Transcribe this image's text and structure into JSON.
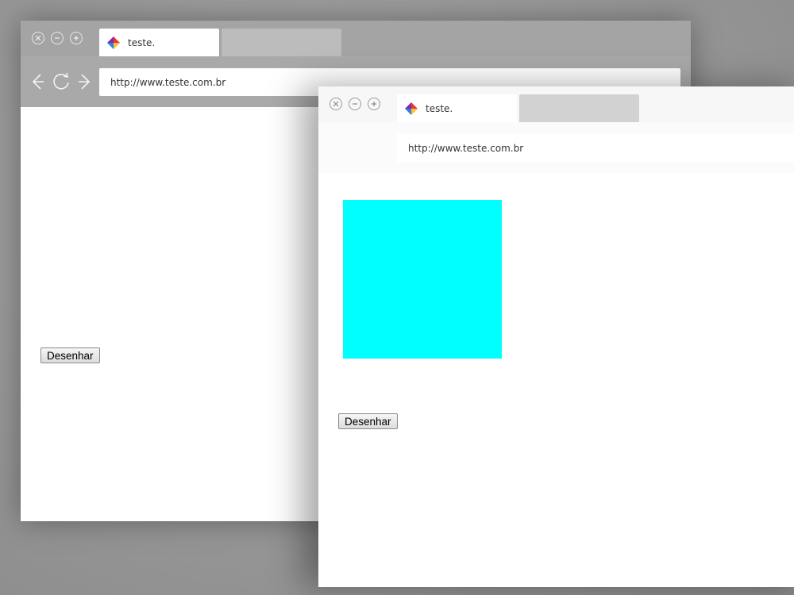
{
  "colors": {
    "square_fill": "#00ffff"
  },
  "back_window": {
    "tab_title": "teste.",
    "url": "http://www.teste.com.br",
    "button_label": "Desenhar",
    "controls": [
      "close-icon",
      "minimize-icon",
      "maximize-icon"
    ],
    "nav": [
      "back-arrow-icon",
      "refresh-icon",
      "forward-arrow-icon"
    ]
  },
  "front_window": {
    "tab_title": "teste.",
    "url": "http://www.teste.com.br",
    "button_label": "Desenhar",
    "controls": [
      "close-icon",
      "minimize-icon",
      "maximize-icon"
    ]
  }
}
